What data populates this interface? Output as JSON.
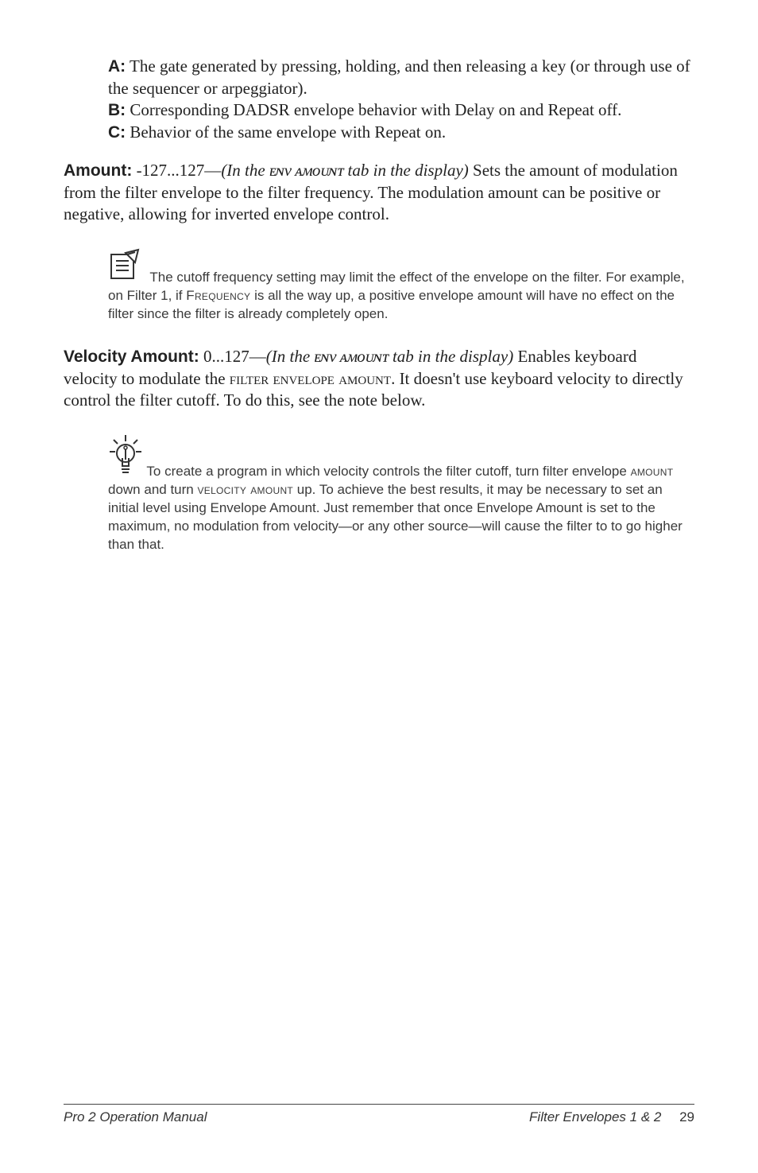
{
  "abc": {
    "a_label": "A:",
    "a_text": " The gate generated by pressing, holding, and then releasing a key (or through use of the sequencer or arpeggiator).",
    "b_label": "B:",
    "b_text": " Corresponding DADSR envelope behavior with Delay on and Repeat off.",
    "c_label": "C:",
    "c_text": " Behavior of the same envelope with Repeat on."
  },
  "amount": {
    "label": "Amount:",
    "range": " -127...127—",
    "ital": "(In the ᴇɴᴠ ᴀᴍᴏᴜɴᴛ tab in the display)",
    "rest": " Sets the amount of modulation from the filter envelope to the filter frequency. The modulation amount can be positive or negative, allowing for inverted envelope control."
  },
  "note1": {
    "pre": " The cutoff frequency setting may limit the effect of the envelope on the filter. For example, on Filter 1, if ",
    "sc": "Frequency",
    "post": " is all the way up, a positive envelope amount will have no effect on the filter since the filter is already completely open."
  },
  "velocity": {
    "label": "Velocity Amount:",
    "range": " 0...127—",
    "ital": "(In the ᴇɴᴠ ᴀᴍᴏᴜɴᴛ tab in the display)",
    "rest_pre": " Enables keyboard velocity to modulate the ",
    "rest_sc": "filter envelope amount",
    "rest_post": ". It doesn't use keyboard velocity to directly control the filter cutoff. To do this, see the note below."
  },
  "tip": {
    "pre": " To create a program in which velocity controls the filter cutoff, turn filter envelope ",
    "sc1": "amount",
    "mid1": " down and turn ",
    "sc2": "velocity amount",
    "post": " up. To achieve the best results, it may be necessary to set an initial level using Envelope Amount. Just remember that once Envelope Amount is set to the maximum, no modulation from velocity—or any other source—will cause the filter to  to go higher than that."
  },
  "footer": {
    "left": "Pro 2 Operation Manual",
    "right_title": "Filter Envelopes 1 & 2",
    "page": "29"
  }
}
